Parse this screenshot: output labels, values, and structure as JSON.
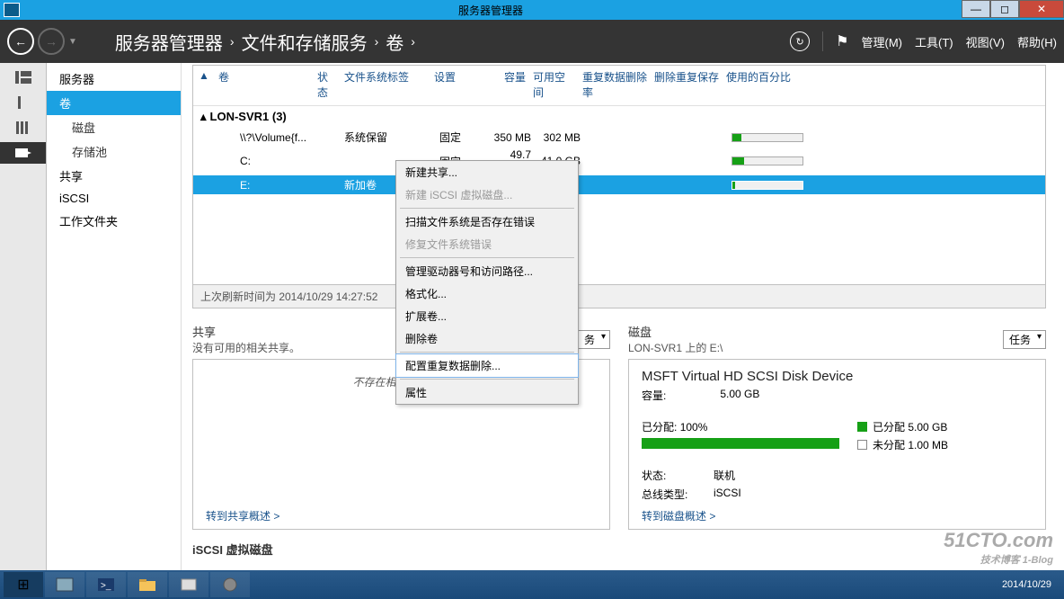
{
  "titlebar": {
    "title": "服务器管理器"
  },
  "winControls": {
    "min": "—",
    "max": "◻",
    "close": "✕"
  },
  "breadcrumb": {
    "root": "服务器管理器",
    "l1": "文件和存储服务",
    "l2": "卷",
    "sep": "›"
  },
  "topMenu": {
    "manage": "管理(M)",
    "tools": "工具(T)",
    "view": "视图(V)",
    "help": "帮助(H)"
  },
  "sidebar": {
    "items": [
      {
        "label": "服务器"
      },
      {
        "label": "卷",
        "selected": true
      },
      {
        "label": "磁盘",
        "sub": true
      },
      {
        "label": "存储池",
        "sub": true
      },
      {
        "label": "共享"
      },
      {
        "label": "iSCSI"
      },
      {
        "label": "工作文件夹"
      }
    ]
  },
  "volumes": {
    "headers": {
      "hat": "▲",
      "vol": "卷",
      "status": "状态",
      "label": "文件系统标签",
      "prov": "设置",
      "cap": "容量",
      "free": "可用空间",
      "dedup": "重复数据删除率",
      "saved": "删除重复保存",
      "pct": "使用的百分比"
    },
    "group": "LON-SVR1 (3)",
    "rows": [
      {
        "vol": "\\\\?\\Volume{f...",
        "label": "系统保留",
        "prov": "固定",
        "cap": "350 MB",
        "free": "302 MB",
        "pct": 13
      },
      {
        "vol": "C:",
        "label": "",
        "prov": "固定",
        "cap": "49.7 GB",
        "free": "41.0 GB",
        "pct": 17
      },
      {
        "vol": "E:",
        "label": "新加卷",
        "prov": "",
        "cap": "",
        "free": "",
        "pct": 4,
        "selected": true
      }
    ],
    "footer": "上次刷新时间为 2014/10/29 14:27:52"
  },
  "contextMenu": {
    "items": [
      {
        "label": "新建共享..."
      },
      {
        "label": "新建 iSCSI 虚拟磁盘...",
        "disabled": true
      },
      {
        "sep": true
      },
      {
        "label": "扫描文件系统是否存在错误"
      },
      {
        "label": "修复文件系统错误",
        "disabled": true
      },
      {
        "sep": true
      },
      {
        "label": "管理驱动器号和访问路径..."
      },
      {
        "label": "格式化..."
      },
      {
        "label": "扩展卷..."
      },
      {
        "label": "删除卷"
      },
      {
        "sep": true
      },
      {
        "label": "配置重复数据删除...",
        "highlight": true
      },
      {
        "sep": true
      },
      {
        "label": "属性"
      }
    ]
  },
  "shares": {
    "title": "共享",
    "sub": "没有可用的相关共享。",
    "tasks": "务",
    "empty": "不存在相关的共享。",
    "link": "转到共享概述 >"
  },
  "disk": {
    "title": "磁盘",
    "sub": "LON-SVR1 上的 E:\\",
    "tasks": "任务",
    "name": "MSFT Virtual HD SCSI Disk Device",
    "capLabel": "容量:",
    "cap": "5.00 GB",
    "allocLabel": "已分配:",
    "allocPct": "100%",
    "legAlloc": "已分配 5.00 GB",
    "legUnalloc": "未分配 1.00 MB",
    "statusLabel": "状态:",
    "status": "联机",
    "busLabel": "总线类型:",
    "bus": "iSCSI",
    "link": "转到磁盘概述 >"
  },
  "iscsi": {
    "title": "iSCSI 虚拟磁盘"
  },
  "watermark": {
    "main": "51CTO.com",
    "sub": "技术博客  1-Blog"
  },
  "taskbar": {
    "date": "2014/10/29"
  }
}
